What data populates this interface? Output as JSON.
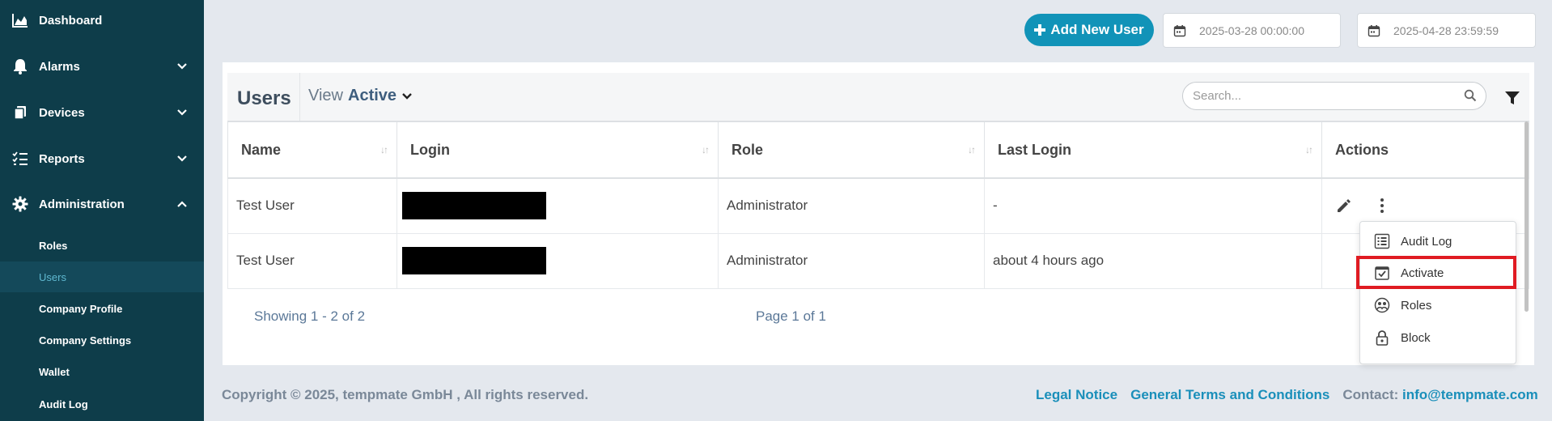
{
  "sidebar": {
    "items": [
      {
        "label": "Dashboard",
        "icon": "chart-area-icon"
      },
      {
        "label": "Alarms",
        "icon": "bell-icon"
      },
      {
        "label": "Devices",
        "icon": "device-icon"
      },
      {
        "label": "Reports",
        "icon": "list-check-icon"
      },
      {
        "label": "Administration",
        "icon": "gear-icon"
      }
    ],
    "sub_items": [
      "Roles",
      "Users",
      "Company Profile",
      "Company Settings",
      "Wallet",
      "Audit Log"
    ]
  },
  "topbar": {
    "add_user_label": "Add New User",
    "date_from": "2025-03-28 00:00:00",
    "date_to": "2025-04-28 23:59:59"
  },
  "card": {
    "title": "Users",
    "view_prefix": "View",
    "view_value": "Active",
    "search_placeholder": "Search..."
  },
  "table": {
    "columns": [
      "Name",
      "Login",
      "Role",
      "Last Login",
      "Actions"
    ],
    "rows": [
      {
        "name": "Test User",
        "role": "Administrator",
        "last_login": "-"
      },
      {
        "name": "Test User",
        "role": "Administrator",
        "last_login": "about 4 hours ago"
      }
    ]
  },
  "pagination": {
    "showing": "Showing 1 - 2 of 2",
    "page": "Page 1 of 1"
  },
  "menu": {
    "items": [
      "Audit Log",
      "Activate",
      "Roles",
      "Block"
    ]
  },
  "footer": {
    "copyright": "Copyright © 2025, tempmate GmbH , All rights reserved.",
    "legal": "Legal Notice",
    "terms": "General Terms and Conditions",
    "contact_label": "Contact:",
    "contact_email": "info@tempmate.com"
  },
  "colors": {
    "sidebar_bg": "#0e3d4a",
    "accent": "#1193b8",
    "highlight": "#e01b22"
  }
}
